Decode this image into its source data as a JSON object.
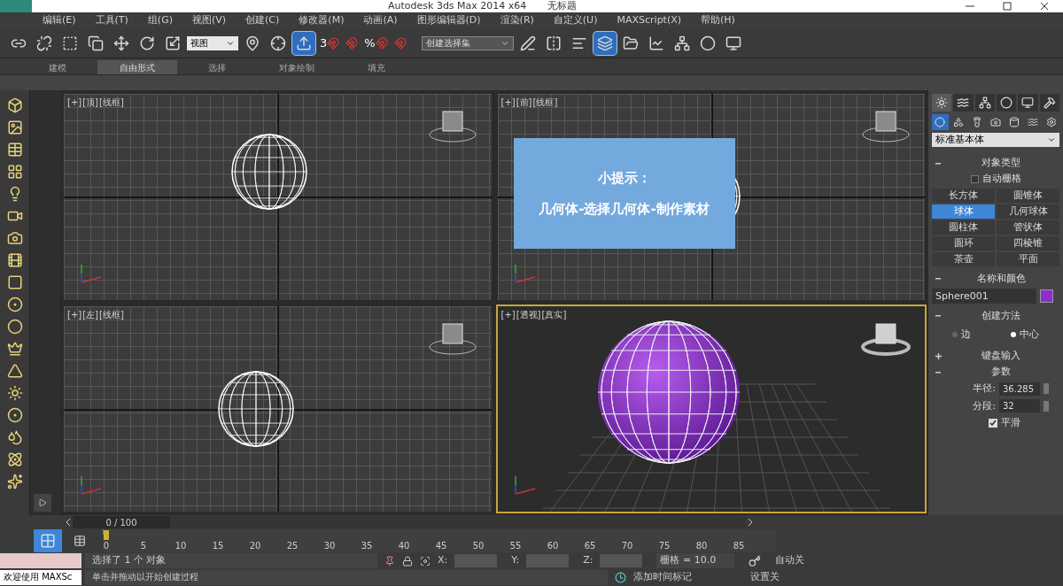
{
  "window": {
    "title": "Autodesk 3ds Max  2014 x64",
    "document": "无标题"
  },
  "menu": [
    "编辑(E)",
    "工具(T)",
    "组(G)",
    "视图(V)",
    "创建(C)",
    "修改器(M)",
    "动画(A)",
    "图形编辑器(D)",
    "渲染(R)",
    "自定义(U)",
    "MAXScript(X)",
    "帮助(H)"
  ],
  "toolbar": {
    "left_buttons": [
      {
        "active": false
      },
      {
        "active": false
      },
      {
        "active": false
      },
      {
        "active": false
      },
      {
        "active": false
      },
      {
        "active": false
      },
      {
        "active": false
      }
    ],
    "view_dropdown": "视图",
    "mid_buttons": [
      {
        "active": false
      },
      {
        "active": false
      },
      {
        "active": true
      }
    ],
    "snaps": [
      {
        "label": "3",
        "active": false
      },
      {
        "active": false
      },
      {
        "label": "%",
        "active": false
      },
      {
        "active": false
      }
    ],
    "selection_set": "创建选择集",
    "right_buttons": [
      {
        "active": false
      },
      {
        "active": false
      },
      {
        "active": false
      },
      {
        "active": true
      },
      {
        "active": false
      },
      {
        "active": false
      },
      {
        "active": false
      },
      {
        "active": false
      },
      {
        "active": false
      }
    ]
  },
  "ribbon_tabs": [
    {
      "label": "建模",
      "selected": false
    },
    {
      "label": "自由形式",
      "selected": true
    },
    {
      "label": "选择",
      "selected": false
    },
    {
      "label": "对象绘制",
      "selected": false
    },
    {
      "label": "填充",
      "selected": false
    }
  ],
  "viewports": [
    {
      "kind": "ortho",
      "menu": "[+]",
      "view": "[顶]",
      "shading": "[线框]",
      "active": false
    },
    {
      "kind": "ortho",
      "menu": "[+]",
      "view": "[前]",
      "shading": "[线框]",
      "active": false
    },
    {
      "kind": "ortho",
      "menu": "[+]",
      "view": "[左]",
      "shading": "[线框]",
      "active": false
    },
    {
      "kind": "perspective",
      "menu": "[+]",
      "view": "[透视]",
      "shading": "[真实]",
      "active": true
    }
  ],
  "tip": {
    "title": "小提示：",
    "text": "几何体-选择几何体-制作素材"
  },
  "command_panel": {
    "tabs": [
      {
        "selected": true
      },
      {
        "selected": false
      },
      {
        "selected": false
      },
      {
        "selected": false
      },
      {
        "selected": false
      },
      {
        "selected": false
      }
    ],
    "categories": [
      {
        "selected": true
      },
      {
        "selected": false
      },
      {
        "selected": false
      },
      {
        "selected": false
      },
      {
        "selected": false
      },
      {
        "selected": false
      },
      {
        "selected": false
      }
    ],
    "type_dropdown": "标准基本体",
    "object_type": {
      "title": "对象类型",
      "expanded": true,
      "autogrid": {
        "label": "自动栅格",
        "checked": false
      },
      "buttons": [
        {
          "label": "长方体",
          "selected": false
        },
        {
          "label": "圆锥体",
          "selected": false
        },
        {
          "label": "球体",
          "selected": true
        },
        {
          "label": "几何球体",
          "selected": false
        },
        {
          "label": "圆柱体",
          "selected": false
        },
        {
          "label": "管状体",
          "selected": false
        },
        {
          "label": "圆环",
          "selected": false
        },
        {
          "label": "四棱锥",
          "selected": false
        },
        {
          "label": "茶壶",
          "selected": false
        },
        {
          "label": "平面",
          "selected": false
        }
      ]
    },
    "name_color": {
      "title": "名称和颜色",
      "expanded": true,
      "name": "Sphere001",
      "color": "#8b2fd0"
    },
    "creation_method": {
      "title": "创建方法",
      "expanded": true,
      "options": [
        {
          "label": "边",
          "selected": false
        },
        {
          "label": "中心",
          "selected": true
        }
      ]
    },
    "keyboard_entry": {
      "title": "键盘输入",
      "expanded": false
    },
    "parameters": {
      "title": "参数",
      "expanded": true,
      "fields": [
        {
          "label": "半径:",
          "value": "36.285"
        },
        {
          "label": "分段:",
          "value": "32"
        }
      ],
      "smooth": {
        "label": "平滑",
        "checked": true
      }
    }
  },
  "timeline": {
    "slider": "0 / 100",
    "level": 0,
    "ticks": [
      "0",
      "5",
      "10",
      "15",
      "20",
      "25",
      "30",
      "35",
      "40",
      "45",
      "50",
      "55",
      "60",
      "65",
      "70",
      "75",
      "80",
      "85"
    ]
  },
  "status": {
    "selection": "选择了 1 个 对象",
    "x_label": "X:",
    "y_label": "Y:",
    "z_label": "Z:",
    "grid": "栅格 = 10.0",
    "auto_key": "自动关",
    "prompt": "单击并拖动以开始创建过程",
    "add_time_tag": "添加时间标记",
    "set_key": "设置关",
    "listener": "欢迎使用 MAXSc"
  }
}
